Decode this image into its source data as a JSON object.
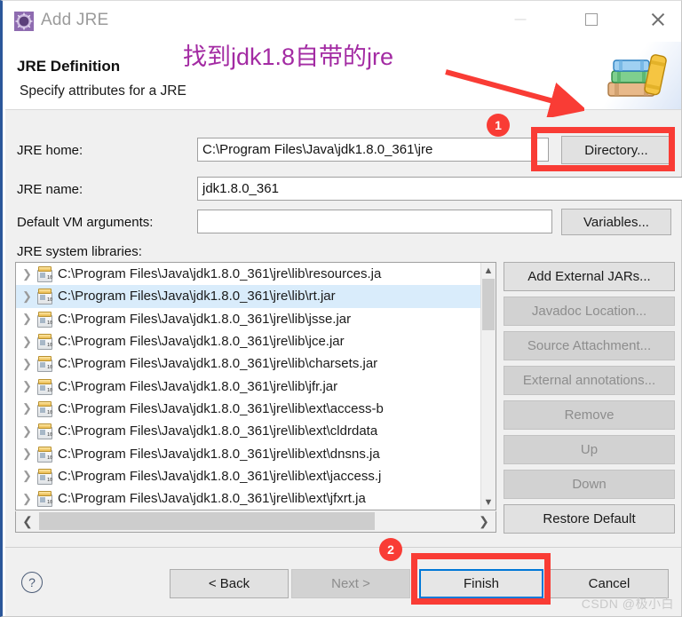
{
  "window": {
    "title": "Add JRE",
    "icon": "jre-gear-icon",
    "controls": {
      "minimize": "minimize-icon",
      "maximize": "maximize-icon",
      "close": "close-icon"
    }
  },
  "header": {
    "title": "JRE Definition",
    "subtitle": "Specify attributes for a JRE",
    "banner_icon": "books-stack-icon"
  },
  "form": {
    "jre_home_label": "JRE home:",
    "jre_home_value": "C:\\Program Files\\Java\\jdk1.8.0_361\\jre",
    "jre_home_placeholder": "",
    "directory_button": "Directory...",
    "jre_name_label": "JRE name:",
    "jre_name_value": "jdk1.8.0_361",
    "jre_name_placeholder": "",
    "vm_args_label": "Default VM arguments:",
    "vm_args_value": "",
    "vm_args_placeholder": "",
    "variables_button": "Variables...",
    "libraries_label": "JRE system libraries:"
  },
  "libraries": [
    {
      "path": "C:\\Program Files\\Java\\jdk1.8.0_361\\jre\\lib\\resources.ja",
      "selected": false
    },
    {
      "path": "C:\\Program Files\\Java\\jdk1.8.0_361\\jre\\lib\\rt.jar",
      "selected": true
    },
    {
      "path": "C:\\Program Files\\Java\\jdk1.8.0_361\\jre\\lib\\jsse.jar",
      "selected": false
    },
    {
      "path": "C:\\Program Files\\Java\\jdk1.8.0_361\\jre\\lib\\jce.jar",
      "selected": false
    },
    {
      "path": "C:\\Program Files\\Java\\jdk1.8.0_361\\jre\\lib\\charsets.jar",
      "selected": false
    },
    {
      "path": "C:\\Program Files\\Java\\jdk1.8.0_361\\jre\\lib\\jfr.jar",
      "selected": false
    },
    {
      "path": "C:\\Program Files\\Java\\jdk1.8.0_361\\jre\\lib\\ext\\access-b",
      "selected": false
    },
    {
      "path": "C:\\Program Files\\Java\\jdk1.8.0_361\\jre\\lib\\ext\\cldrdata",
      "selected": false
    },
    {
      "path": "C:\\Program Files\\Java\\jdk1.8.0_361\\jre\\lib\\ext\\dnsns.ja",
      "selected": false
    },
    {
      "path": "C:\\Program Files\\Java\\jdk1.8.0_361\\jre\\lib\\ext\\jaccess.j",
      "selected": false
    },
    {
      "path": "C:\\Program Files\\Java\\jdk1.8.0_361\\jre\\lib\\ext\\jfxrt.ja",
      "selected": false
    }
  ],
  "side_buttons": [
    {
      "label": "Add External JARs...",
      "enabled": true
    },
    {
      "label": "Javadoc Location...",
      "enabled": false
    },
    {
      "label": "Source Attachment...",
      "enabled": false
    },
    {
      "label": "External annotations...",
      "enabled": false
    },
    {
      "label": "Remove",
      "enabled": false
    },
    {
      "label": "Up",
      "enabled": false
    },
    {
      "label": "Down",
      "enabled": false
    },
    {
      "label": "Restore Default",
      "enabled": true
    }
  ],
  "footer": {
    "help_icon": "help-question-icon",
    "back_button": "< Back",
    "next_button": "Next >",
    "finish_button": "Finish",
    "cancel_button": "Cancel"
  },
  "annotations": {
    "note_text": "找到jdk1.8自带的jre",
    "note_color": "#a32ba3",
    "highlight_color": "#f93c35",
    "badge_1": "1",
    "badge_2": "2"
  },
  "watermark": "CSDN @极小白"
}
